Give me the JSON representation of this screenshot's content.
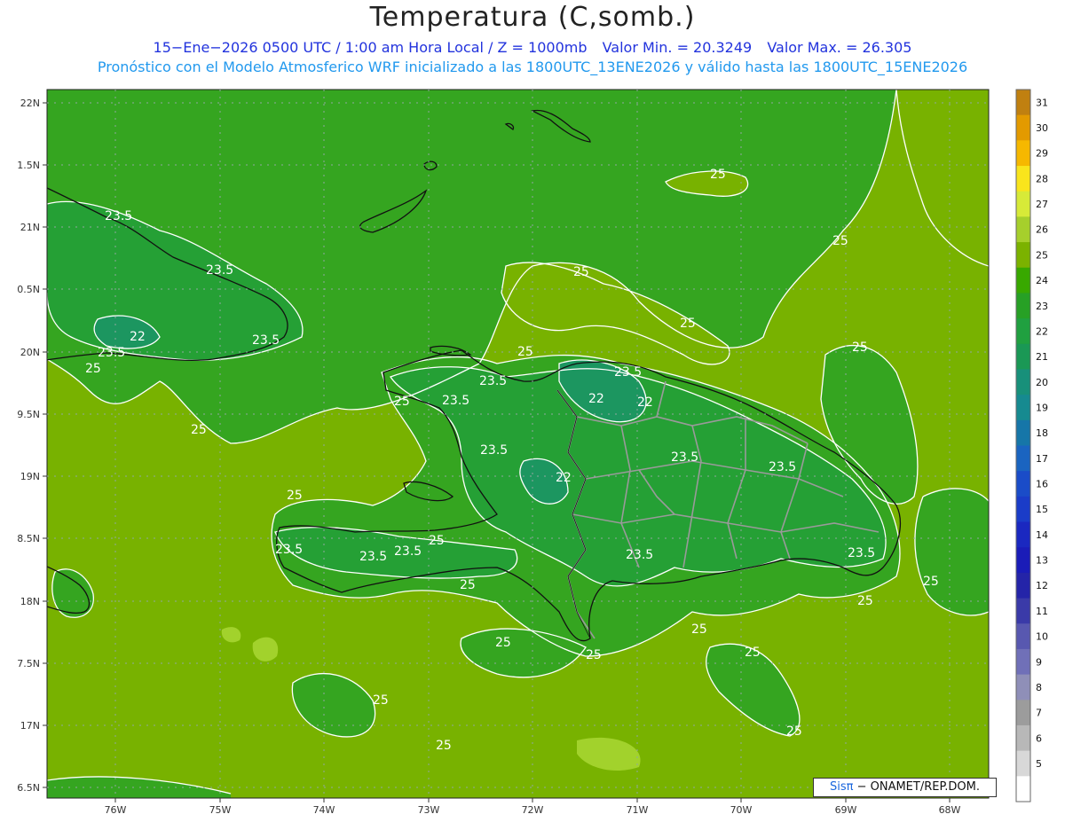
{
  "header": {
    "title": "Temperatura (C,somb.)",
    "valid_time": "15−Ene−2026  0500 UTC / 1:00 am Hora Local / Z = 1000mb",
    "min_label": "Valor Min. = 20.3249",
    "max_label": "Valor Max. = 26.305",
    "model_info": "Pronóstico con el Modelo Atmosferico WRF inicializado a las 1800UTC_13ENE2026 y válido hasta las  1800UTC_15ENE2026"
  },
  "map": {
    "lon_ticks": [
      "76W",
      "75W",
      "74W",
      "73W",
      "72W",
      "71W",
      "70W",
      "69W",
      "68W"
    ],
    "lat_ticks": [
      "22N",
      "1.5N",
      "21N",
      "0.5N",
      "20N",
      "9.5N",
      "19N",
      "8.5N",
      "18N",
      "7.5N",
      "17N",
      "6.5N"
    ],
    "contour_labels": [
      {
        "text": "23.5"
      },
      {
        "text": "23.5"
      },
      {
        "text": "22"
      },
      {
        "text": "23.5"
      },
      {
        "text": "23.5"
      },
      {
        "text": "25"
      },
      {
        "text": "25"
      },
      {
        "text": "25"
      },
      {
        "text": "25"
      },
      {
        "text": "25"
      },
      {
        "text": "25"
      },
      {
        "text": "25"
      },
      {
        "text": "25"
      },
      {
        "text": "23.5"
      },
      {
        "text": "23.5"
      },
      {
        "text": "23.5"
      },
      {
        "text": "22"
      },
      {
        "text": "22"
      },
      {
        "text": "22"
      },
      {
        "text": "23.5"
      },
      {
        "text": "23.5"
      },
      {
        "text": "23.5"
      },
      {
        "text": "23.5"
      },
      {
        "text": "23.5"
      },
      {
        "text": "23.5"
      },
      {
        "text": "23.5"
      },
      {
        "text": "23.5"
      },
      {
        "text": "25"
      },
      {
        "text": "25"
      },
      {
        "text": "25"
      },
      {
        "text": "25"
      },
      {
        "text": "25"
      },
      {
        "text": "25"
      },
      {
        "text": "25"
      },
      {
        "text": "25"
      },
      {
        "text": "25"
      },
      {
        "text": "25"
      },
      {
        "text": "25"
      },
      {
        "text": "25"
      },
      {
        "text": "25"
      }
    ]
  },
  "colorbar": {
    "levels": [
      "31",
      "30",
      "29",
      "28",
      "27",
      "26",
      "25",
      "24",
      "23",
      "22",
      "21",
      "20",
      "19",
      "18",
      "17",
      "16",
      "15",
      "14",
      "13",
      "12",
      "11",
      "10",
      "9",
      "8",
      "7",
      "6",
      "5"
    ],
    "colors": [
      "#c08010",
      "#e39a00",
      "#f6b800",
      "#f9e51c",
      "#d7ea38",
      "#a6cf2c",
      "#7bb200",
      "#38a800",
      "#27a025",
      "#20a040",
      "#1a9855",
      "#18907a",
      "#168a90",
      "#1676a8",
      "#1a64c0",
      "#1a4cc8",
      "#1a3cc8",
      "#1a28c0",
      "#1a1cb8",
      "#2424a8",
      "#3a3aa8",
      "#5858b0",
      "#7070b8",
      "#8f8fb8",
      "#9c9c9c",
      "#b8b8b8",
      "#d8d8d8",
      "#ffffff"
    ]
  },
  "credit": {
    "brand": "Sisπ",
    "org": " − ONAMET/REP.DOM."
  }
}
